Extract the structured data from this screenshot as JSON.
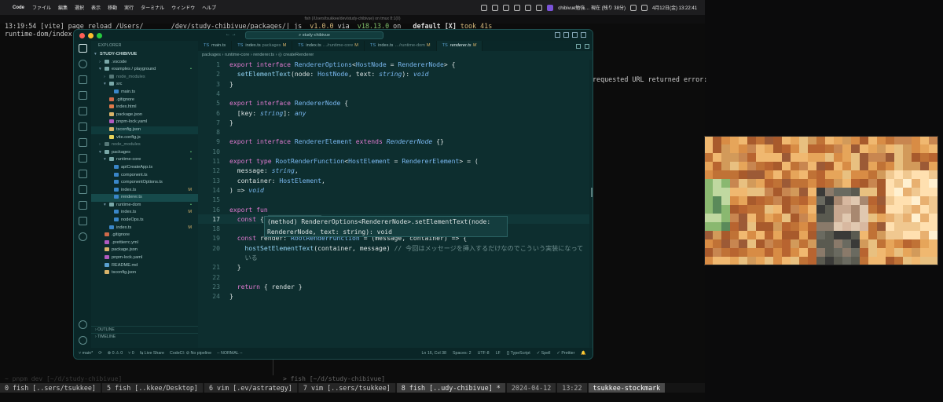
{
  "menubar": {
    "app": "Code",
    "items": [
      "ファイル",
      "編集",
      "選択",
      "表示",
      "移動",
      "実行",
      "ターミナル",
      "ウィンドウ",
      "ヘルプ"
    ],
    "notification": "chibivue勉強… 現在 (残り 38分)",
    "datetime": "4月12日(金) 13:22:41"
  },
  "terminal": {
    "title": "fish (/Users/tsukkee/dev/study-chibivue) on tmux 8:1(0)",
    "line1_time": "13:19:54",
    "line1_text": " [vite] page reload /Users/",
    "line1_path": "       /dev/study-chibivue/packages/",
    "line1_rest": "| js ",
    "line1_ver": " v1.0.0",
    "line1_via": " via ",
    "line1_node": " v18.13.0",
    "line1_on": " on   ",
    "line1_branch": "default [X]",
    "line1_took": " took 41s",
    "line2": "runtime-dom/index.",
    "right_msg": "requested URL returned error:",
    "faded_prompt": "~ pnpm dev [~/d/study-chibivue]",
    "fish_prompt": "> fish [~/d/study-chibivue]",
    "tmux": [
      "0 fish [..sers/tsukkee]",
      "5 fish [..kkee/Desktop]",
      "6 vim [.ev/astrategy]",
      "7 vim [..sers/tsukkee]",
      "8 fish [..udy-chibivue] *",
      "2024-04-12",
      "13:22",
      "tsukkee-stockmark"
    ]
  },
  "vscode": {
    "command_center": "study-chibivue",
    "explorer_title": "EXPLORER",
    "tree": [
      {
        "label": "STUDY-CHIBIVUE",
        "arrow": "▾",
        "indent": 0,
        "kind": "root"
      },
      {
        "label": ".vscode",
        "arrow": "›",
        "indent": 1,
        "kind": "folder"
      },
      {
        "label": "examples / playground",
        "arrow": "▾",
        "indent": 1,
        "kind": "folder",
        "mark": "•",
        "mc": "y"
      },
      {
        "label": "node_modules",
        "arrow": "›",
        "indent": 2,
        "kind": "folder-dim"
      },
      {
        "label": "src",
        "arrow": "▾",
        "indent": 2,
        "kind": "folder"
      },
      {
        "label": "main.ts",
        "indent": 3,
        "kind": "ts"
      },
      {
        "label": ".gitignore",
        "indent": 2,
        "kind": "git"
      },
      {
        "label": "index.html",
        "indent": 2,
        "kind": "html"
      },
      {
        "label": "package.json",
        "indent": 2,
        "kind": "json"
      },
      {
        "label": "pnpm-lock.yaml",
        "indent": 2,
        "kind": "yaml"
      },
      {
        "label": "tsconfig.json",
        "indent": 2,
        "kind": "json",
        "hi": true
      },
      {
        "label": "vite.config.js",
        "indent": 2,
        "kind": "js"
      },
      {
        "label": "node_modules",
        "arrow": "›",
        "indent": 1,
        "kind": "folder-dim"
      },
      {
        "label": "packages",
        "arrow": "▾",
        "indent": 1,
        "kind": "folder",
        "mark": "•",
        "mc": "y"
      },
      {
        "label": "runtime-core",
        "arrow": "▾",
        "indent": 2,
        "kind": "folder",
        "mark": "•",
        "mc": "y"
      },
      {
        "label": "apiCreateApp.ts",
        "indent": 3,
        "kind": "ts"
      },
      {
        "label": "component.ts",
        "indent": 3,
        "kind": "ts"
      },
      {
        "label": "componentOptions.ts",
        "indent": 3,
        "kind": "ts"
      },
      {
        "label": "index.ts",
        "indent": 3,
        "kind": "ts",
        "mark": "M",
        "mc": "m"
      },
      {
        "label": "renderer.ts",
        "indent": 3,
        "kind": "ts",
        "sel": true
      },
      {
        "label": "runtime-dom",
        "arrow": "▾",
        "indent": 2,
        "kind": "folder",
        "mark": "•",
        "mc": "y"
      },
      {
        "label": "index.ts",
        "indent": 3,
        "kind": "ts",
        "mark": "M",
        "mc": "m"
      },
      {
        "label": "nodeOps.ts",
        "indent": 3,
        "kind": "ts"
      },
      {
        "label": "index.ts",
        "indent": 2,
        "kind": "ts",
        "mark": "M",
        "mc": "m"
      },
      {
        "label": ".gitignore",
        "indent": 1,
        "kind": "git"
      },
      {
        "label": ".prettierrc.yml",
        "indent": 1,
        "kind": "yaml"
      },
      {
        "label": "package.json",
        "indent": 1,
        "kind": "json"
      },
      {
        "label": "pnpm-lock.yaml",
        "indent": 1,
        "kind": "yaml"
      },
      {
        "label": "README.md",
        "indent": 1,
        "kind": "md"
      },
      {
        "label": "tsconfig.json",
        "indent": 1,
        "kind": "json"
      }
    ],
    "outline": "OUTLINE",
    "timeline": "TIMELINE",
    "tabs": [
      {
        "name": "main.ts",
        "dim": "",
        "mk": ""
      },
      {
        "name": "index.ts",
        "dim": "packages",
        "mk": "M"
      },
      {
        "name": "index.ts",
        "dim": "…/runtime-core",
        "mk": "M"
      },
      {
        "name": "index.ts",
        "dim": "…/runtime-dom",
        "mk": "M"
      },
      {
        "name": "renderer.ts",
        "dim": "",
        "mk": "M",
        "active": true
      }
    ],
    "breadcrumb": "packages › runtime-core › renderer.ts › ◎ createRenderer",
    "hover_line1": "(method) RendererOptions<RendererNode>.setElementText(node:",
    "hover_line2": "RendererNode, text: string): void",
    "statusbar_left": [
      "⑂ main*",
      "⟳",
      "⊗ 0 ⚠ 0",
      "⑂ 0",
      "⇆ Live Share",
      "CodeCl: ⊘ No pipeline",
      "-- NORMAL --"
    ],
    "statusbar_right": [
      "Ln 16, Col 38",
      "Spaces: 2",
      "UTF-8",
      "LF",
      "{} TypeScript",
      "✓ Spell",
      "✓ Prettier",
      "🔔"
    ]
  }
}
